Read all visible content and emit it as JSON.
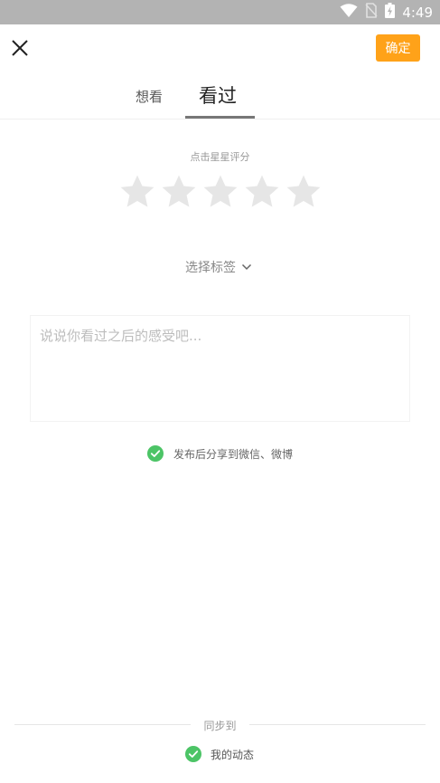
{
  "status_bar": {
    "time": "4:49",
    "icons": [
      "wifi-icon",
      "no-sim-icon",
      "battery-icon"
    ]
  },
  "header": {
    "close_icon": "close-icon",
    "confirm_label": "确定",
    "confirm_color": "#ffa219"
  },
  "tabs": {
    "items": [
      {
        "label": "想看",
        "active": false
      },
      {
        "label": "看过",
        "active": true
      }
    ]
  },
  "rating": {
    "hint": "点击星星评分",
    "max_stars": 5,
    "current": 0,
    "star_color": "#e6e6e6"
  },
  "tag_selector": {
    "label": "选择标签",
    "icon": "chevron-down-icon"
  },
  "comment": {
    "placeholder": "说说你看过之后的感受吧...",
    "value": ""
  },
  "share": {
    "label": "发布后分享到微信、微博",
    "checked": true,
    "check_color": "#4cc466"
  },
  "sync": {
    "title": "同步到",
    "items": [
      {
        "label": "我的动态",
        "checked": true
      }
    ]
  }
}
